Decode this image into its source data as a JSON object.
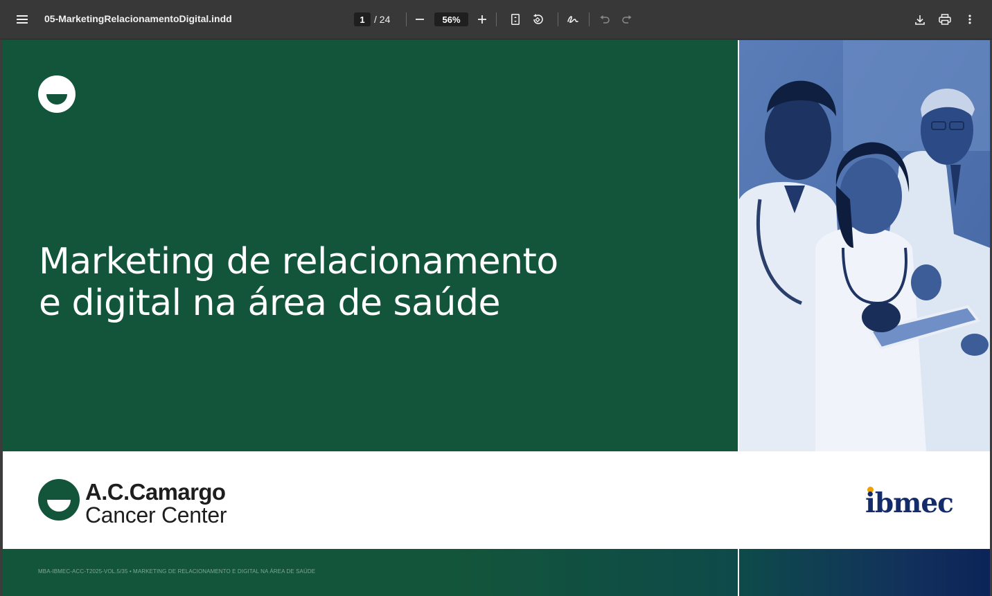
{
  "toolbar": {
    "menu_icon": "hamburger-menu-icon",
    "document_title": "05-MarketingRelacionamentoDigital.indd",
    "current_page": "1",
    "page_total": "/ 24",
    "zoom": "56%",
    "icons": [
      "minus-icon",
      "plus-icon",
      "fit-page-icon",
      "rotate-icon",
      "draw-icon",
      "undo-icon",
      "redo-icon",
      "download-icon",
      "print-icon",
      "more-vert-icon"
    ]
  },
  "page": {
    "title_line1": "Marketing de relacionamento",
    "title_line2": "e digital na área de saúde",
    "photo_alt": "doctors-looking-at-tablet-photo",
    "brand": {
      "name": "A.C.Camargo",
      "subtitle": "Cancer Center"
    },
    "partner_logo": "ibmec",
    "footer_text": "MBA-IBMEC-ACC-T2025-VOL.5/35 • MARKETING DE RELACIONAMENTO E DIGITAL NA ÁREA DE SAÚDE"
  },
  "colors": {
    "toolbar_bg": "#383838",
    "brand_green": "#13553a",
    "photo_blue": "#4b6ea8",
    "ibmec_navy": "#142d6a",
    "ibmec_orange": "#f0a100"
  }
}
